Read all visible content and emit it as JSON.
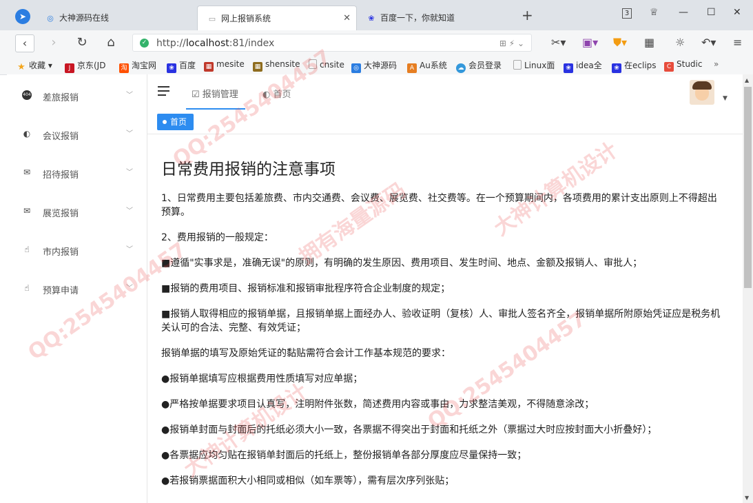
{
  "browser": {
    "tabs": [
      {
        "label": "大神源码在线",
        "icon": "browser-logo-icon"
      },
      {
        "label": "网上报销系统",
        "icon": "page-icon"
      },
      {
        "label": "百度一下，你就知道",
        "icon": "baidu-paw-icon"
      }
    ],
    "tab_count": "3",
    "url_prefix": "http://",
    "url_host": "localhost",
    "url_rest": ":81/index"
  },
  "bookmarks": [
    {
      "label": "收藏",
      "icon": "star-icon",
      "color": "#f4a61d"
    },
    {
      "label": "京东(JD",
      "icon": "jd-icon",
      "color": "#c81623"
    },
    {
      "label": "淘宝网",
      "icon": "taobao-icon",
      "color": "#ff5000"
    },
    {
      "label": "百度",
      "icon": "baidu-paw-icon",
      "color": "#2932e1"
    },
    {
      "label": "mesite",
      "icon": "site-icon",
      "color": "#c0392b"
    },
    {
      "label": "shensite",
      "icon": "site-icon",
      "color": "#8e6c1e"
    },
    {
      "label": "cnsite",
      "icon": "page-icon",
      "color": "#999999"
    },
    {
      "label": "大神源码",
      "icon": "browser-logo-icon",
      "color": "#2b7de1"
    },
    {
      "label": "Au系统",
      "icon": "au-icon",
      "color": "#e67e22"
    },
    {
      "label": "会员登录",
      "icon": "cloud-icon",
      "color": "#3498db"
    },
    {
      "label": "Linux面",
      "icon": "page-icon",
      "color": "#999999"
    },
    {
      "label": "idea全",
      "icon": "baidu-paw-icon",
      "color": "#2932e1"
    },
    {
      "label": "在eclips",
      "icon": "baidu-paw-icon",
      "color": "#2932e1"
    },
    {
      "label": "Studic",
      "icon": "c-icon",
      "color": "#e74c3c"
    }
  ],
  "sidebar": {
    "items": [
      {
        "label": "差旅报销",
        "icon": "404-badge-icon"
      },
      {
        "label": "会议报销",
        "icon": "palette-icon"
      },
      {
        "label": "招待报销",
        "icon": "mail-icon"
      },
      {
        "label": "展览报销",
        "icon": "mail-icon"
      },
      {
        "label": "市内报销",
        "icon": "hand-icon"
      },
      {
        "label": "预算申请",
        "icon": "hand-icon"
      }
    ]
  },
  "header": {
    "tabs": [
      {
        "label": "报销管理",
        "icon": "checkbox-icon",
        "active": true
      },
      {
        "label": "首页",
        "icon": "palette-icon",
        "active": false
      }
    ]
  },
  "breadcrumb": {
    "label": "首页"
  },
  "content": {
    "title": "日常费用报销的注意事项",
    "paragraphs": [
      "1、日常费用主要包括差旅费、市内交通费、会议费、展览费、社交费等。在一个预算期间内，各项费用的累计支出原则上不得超出预算。",
      "2、费用报销的一般规定：",
      "■遵循\"实事求是，准确无误\"的原则，有明确的发生原因、费用项目、发生时间、地点、金额及报销人、审批人；",
      "■报销的费用项目、报销标准和报销审批程序符合企业制度的规定；",
      "■报销人取得相应的报销单据，且报销单据上面经办人、验收证明（复核）人、审批人签名齐全，报销单据所附原始凭证应是税务机关认可的合法、完整、有效凭证；",
      "报销单据的填写及原始凭证的黏贴需符合会计工作基本规范的要求：",
      "●报销单据填写应根据费用性质填写对应单据；",
      "●严格按单据要求项目认真写，注明附件张数，简述费用内容或事由，力求整洁美观，不得随意涂改；",
      "●报销单封面与封面后的托纸必须大小一致，各票据不得突出于封面和托纸之外（票据过大时应按封面大小折叠好）；",
      "●各票据应均匀贴在报销单封面后的托纸上，整份报销单各部分厚度应尽量保持一致；",
      "●若报销票据面积大小相同或相似（如车票等），需有层次序列张贴；"
    ]
  },
  "watermark": {
    "texts": [
      "QQ:2545404457",
      "拥有海量源码",
      "大神计算机设计"
    ],
    "color": "#e64646"
  },
  "accent_color": "#2d8cf0"
}
